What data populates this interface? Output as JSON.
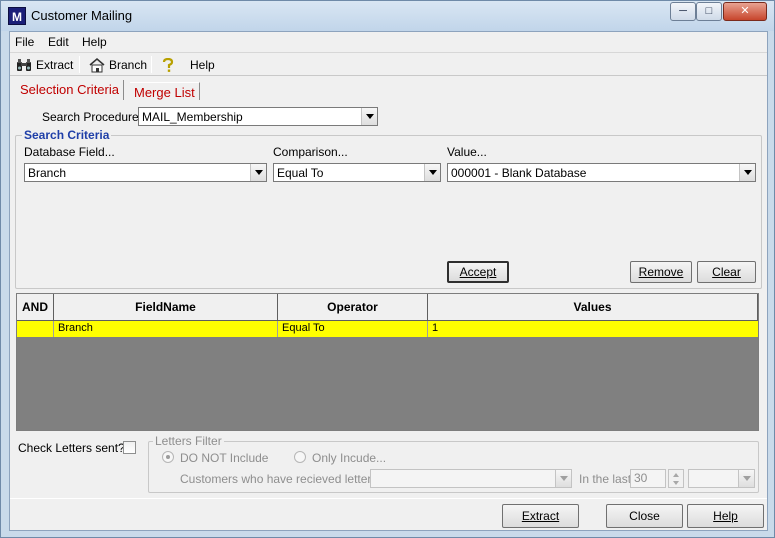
{
  "window": {
    "title": "Customer Mailing",
    "icon_letter": "M",
    "minimize": "0",
    "maximize": "1",
    "close": "r"
  },
  "menu": {
    "file": "File",
    "edit": "Edit",
    "help": "Help"
  },
  "toolbar": {
    "extract": "Extract",
    "branch": "Branch",
    "help": "Help"
  },
  "tabs": {
    "selection": "Selection Criteria",
    "merge": "Merge List"
  },
  "search_procedure": {
    "label": "Search Procedure:",
    "value": "MAIL_Membership"
  },
  "search_criteria": {
    "title": "Search Criteria",
    "field_label": "Database Field...",
    "field_value": "Branch",
    "comparison_label": "Comparison...",
    "comparison_value": "Equal To",
    "value_label": "Value...",
    "value_value": "000001 - Blank Database",
    "accept": "Accept",
    "remove": "Remove",
    "clear": "Clear"
  },
  "grid": {
    "columns": [
      "AND",
      "FieldName",
      "Operator",
      "Values"
    ],
    "rows": [
      {
        "and": "",
        "field": "Branch",
        "operator": "Equal To",
        "value": "1"
      }
    ]
  },
  "letters": {
    "check_label": "Check Letters sent?",
    "filter_title": "Letters Filter",
    "do_not_include": "DO NOT Include",
    "only_include": "Only Incude...",
    "customers_label": "Customers who have recieved letter...",
    "in_the_last": "In the last",
    "days": "30"
  },
  "footer": {
    "extract": "Extract",
    "close": "Close",
    "help": "Help"
  }
}
